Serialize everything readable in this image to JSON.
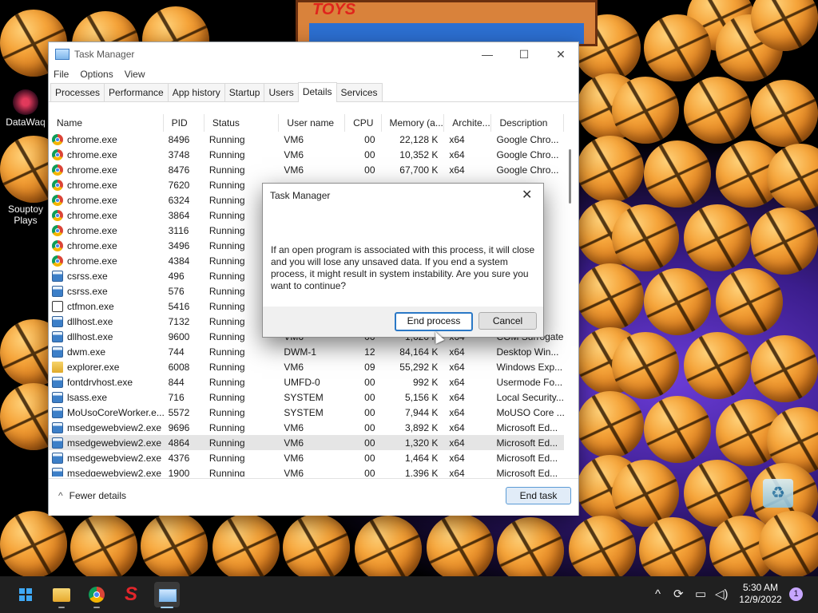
{
  "desktop": {
    "poster_text": "TOYS",
    "icons": [
      {
        "label": "DataWaq"
      },
      {
        "label": "Souptoy Plays"
      }
    ],
    "ball_text": "BASKETBALL"
  },
  "window": {
    "title": "Task Manager",
    "menu": [
      "File",
      "Options",
      "View"
    ],
    "tabs": [
      "Processes",
      "Performance",
      "App history",
      "Startup",
      "Users",
      "Details",
      "Services"
    ],
    "active_tab": "Details",
    "columns": [
      "Name",
      "PID",
      "Status",
      "User name",
      "CPU",
      "Memory (a...",
      "Archite...",
      "Description"
    ],
    "rows": [
      {
        "icon": "chrome-icon",
        "name": "chrome.exe",
        "pid": "8496",
        "status": "Running",
        "user": "VM6",
        "cpu": "00",
        "mem": "22,128 K",
        "arch": "x64",
        "desc": "Google Chro..."
      },
      {
        "icon": "chrome-icon",
        "name": "chrome.exe",
        "pid": "3748",
        "status": "Running",
        "user": "VM6",
        "cpu": "00",
        "mem": "10,352 K",
        "arch": "x64",
        "desc": "Google Chro..."
      },
      {
        "icon": "chrome-icon",
        "name": "chrome.exe",
        "pid": "8476",
        "status": "Running",
        "user": "VM6",
        "cpu": "00",
        "mem": "67,700 K",
        "arch": "x64",
        "desc": "Google Chro..."
      },
      {
        "icon": "chrome-icon",
        "name": "chrome.exe",
        "pid": "7620",
        "status": "Running",
        "user": "",
        "cpu": "",
        "mem": "",
        "arch": "",
        "desc": ""
      },
      {
        "icon": "chrome-icon",
        "name": "chrome.exe",
        "pid": "6324",
        "status": "Running",
        "user": "",
        "cpu": "",
        "mem": "",
        "arch": "",
        "desc": ""
      },
      {
        "icon": "chrome-icon",
        "name": "chrome.exe",
        "pid": "3864",
        "status": "Running",
        "user": "",
        "cpu": "",
        "mem": "",
        "arch": "",
        "desc": ""
      },
      {
        "icon": "chrome-icon",
        "name": "chrome.exe",
        "pid": "3116",
        "status": "Running",
        "user": "",
        "cpu": "",
        "mem": "",
        "arch": "",
        "desc": ""
      },
      {
        "icon": "chrome-icon",
        "name": "chrome.exe",
        "pid": "3496",
        "status": "Running",
        "user": "",
        "cpu": "",
        "mem": "",
        "arch": "",
        "desc": ""
      },
      {
        "icon": "chrome-icon",
        "name": "chrome.exe",
        "pid": "4384",
        "status": "Running",
        "user": "",
        "cpu": "",
        "mem": "",
        "arch": "",
        "desc": ""
      },
      {
        "icon": "app-box-icon",
        "name": "csrss.exe",
        "pid": "496",
        "status": "Running",
        "user": "",
        "cpu": "",
        "mem": "",
        "arch": "",
        "desc": ""
      },
      {
        "icon": "app-box-icon",
        "name": "csrss.exe",
        "pid": "576",
        "status": "Running",
        "user": "",
        "cpu": "",
        "mem": "",
        "arch": "",
        "desc": ""
      },
      {
        "icon": "edit-icon",
        "name": "ctfmon.exe",
        "pid": "5416",
        "status": "Running",
        "user": "",
        "cpu": "",
        "mem": "",
        "arch": "",
        "desc": ""
      },
      {
        "icon": "app-box-icon",
        "name": "dllhost.exe",
        "pid": "7132",
        "status": "Running",
        "user": "",
        "cpu": "",
        "mem": "",
        "arch": "",
        "desc": "...gate"
      },
      {
        "icon": "app-box-icon",
        "name": "dllhost.exe",
        "pid": "9600",
        "status": "Running",
        "user": "VM6",
        "cpu": "00",
        "mem": "1,620 K",
        "arch": "x64",
        "desc": "COM Surrogate"
      },
      {
        "icon": "app-box-icon",
        "name": "dwm.exe",
        "pid": "744",
        "status": "Running",
        "user": "DWM-1",
        "cpu": "12",
        "mem": "84,164 K",
        "arch": "x64",
        "desc": "Desktop Win..."
      },
      {
        "icon": "folder-icon",
        "name": "explorer.exe",
        "pid": "6008",
        "status": "Running",
        "user": "VM6",
        "cpu": "09",
        "mem": "55,292 K",
        "arch": "x64",
        "desc": "Windows Exp..."
      },
      {
        "icon": "app-box-icon",
        "name": "fontdrvhost.exe",
        "pid": "844",
        "status": "Running",
        "user": "UMFD-0",
        "cpu": "00",
        "mem": "992 K",
        "arch": "x64",
        "desc": "Usermode Fo..."
      },
      {
        "icon": "app-box-icon",
        "name": "lsass.exe",
        "pid": "716",
        "status": "Running",
        "user": "SYSTEM",
        "cpu": "00",
        "mem": "5,156 K",
        "arch": "x64",
        "desc": "Local Security..."
      },
      {
        "icon": "app-box-icon",
        "name": "MoUsoCoreWorker.e...",
        "pid": "5572",
        "status": "Running",
        "user": "SYSTEM",
        "cpu": "00",
        "mem": "7,944 K",
        "arch": "x64",
        "desc": "MoUSO Core ..."
      },
      {
        "icon": "app-box-icon",
        "name": "msedgewebview2.exe",
        "pid": "9696",
        "status": "Running",
        "user": "VM6",
        "cpu": "00",
        "mem": "3,892 K",
        "arch": "x64",
        "desc": "Microsoft Ed..."
      },
      {
        "icon": "app-box-icon",
        "name": "msedgewebview2.exe",
        "pid": "4864",
        "status": "Running",
        "user": "VM6",
        "cpu": "00",
        "mem": "1,320 K",
        "arch": "x64",
        "desc": "Microsoft Ed...",
        "selected": true
      },
      {
        "icon": "app-box-icon",
        "name": "msedgewebview2.exe",
        "pid": "4376",
        "status": "Running",
        "user": "VM6",
        "cpu": "00",
        "mem": "1,464 K",
        "arch": "x64",
        "desc": "Microsoft Ed..."
      },
      {
        "icon": "app-box-icon",
        "name": "msedgewebview2.exe",
        "pid": "1900",
        "status": "Running",
        "user": "VM6",
        "cpu": "00",
        "mem": "1,396 K",
        "arch": "x64",
        "desc": "Microsoft Ed..."
      }
    ],
    "fewer_details": "Fewer details",
    "end_task": "End task"
  },
  "dialog": {
    "title": "Task Manager",
    "message": "If an open program is associated with this process, it will close and you will lose any unsaved data. If you end a system process, it might result in system instability. Are you sure you want to continue?",
    "end_process": "End process",
    "cancel": "Cancel"
  },
  "taskbar": {
    "time": "5:30 AM",
    "date": "12/9/2022",
    "notifications": "1"
  }
}
